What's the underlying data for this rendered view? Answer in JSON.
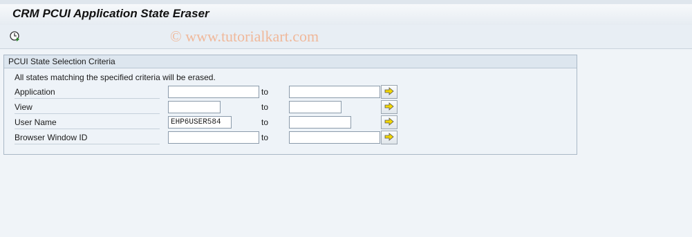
{
  "window": {
    "title": "CRM PCUI Application State Eraser"
  },
  "toolbar": {
    "execute_icon": "execute-clock-icon",
    "watermark": "© www.tutorialkart.com"
  },
  "group": {
    "title": "PCUI State Selection Criteria",
    "info": "All states matching the specified criteria will be erased.",
    "to_label": "to",
    "rows": [
      {
        "label": "Application",
        "from": "",
        "to": ""
      },
      {
        "label": "View",
        "from": "",
        "to": ""
      },
      {
        "label": "User Name",
        "from": "EHP6USER584",
        "to": ""
      },
      {
        "label": "Browser Window ID",
        "from": "",
        "to": ""
      }
    ]
  },
  "colors": {
    "background": "#f0f4f8",
    "group_header": "#dde6ef",
    "arrow": "#f2d600"
  },
  "icons": {
    "multiple_selection": "arrow-right-icon"
  }
}
